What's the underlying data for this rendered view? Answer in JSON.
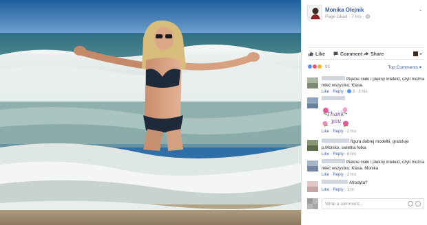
{
  "post": {
    "author": "Monika Olejnik",
    "meta_text": "Page Liked · 7 hrs ·",
    "chevron_icon": "chevron-down-icon",
    "globe_icon": "globe-icon"
  },
  "actions": {
    "like": "Like",
    "comment": "Comment",
    "share": "Share"
  },
  "reactions": {
    "count": "91",
    "sort_label": "Top Comments ▾",
    "types": [
      "like",
      "love",
      "wow"
    ],
    "colors": {
      "like": "#5890ff",
      "love": "#f25268",
      "wow": "#f7b125"
    }
  },
  "comments": [
    {
      "text": "Piękne ciało i piękny intelekt, czyli można mieć wszystko. Klasa.",
      "actions": {
        "like": "Like",
        "reply": "Reply",
        "reactions": "3",
        "time": "3 hrs"
      }
    },
    {
      "text": "",
      "sticker_text": "Thank you",
      "actions": {
        "like": "Like",
        "reply": "Reply",
        "time": "2 hrs"
      }
    },
    {
      "text": "figura dobrej modelki, gratuluje p.Moniko, swietna fotka",
      "actions": {
        "like": "Like",
        "reply": "Reply",
        "time": "6 hrs"
      }
    },
    {
      "text": "Piekne ciało i piekny intelekt, czyli można mieć wszystko. Klasa. Monika",
      "actions": {
        "like": "Like",
        "reply": "Reply",
        "time": "2 hrs"
      }
    },
    {
      "text": "Afrodyta?",
      "actions": {
        "like": "Like",
        "reply": "Reply",
        "time": "1 hr"
      }
    }
  ],
  "composer": {
    "placeholder": "Write a comment..."
  },
  "colors": {
    "link": "#365899",
    "action_link": "#4267b2",
    "meta": "#90949c"
  }
}
